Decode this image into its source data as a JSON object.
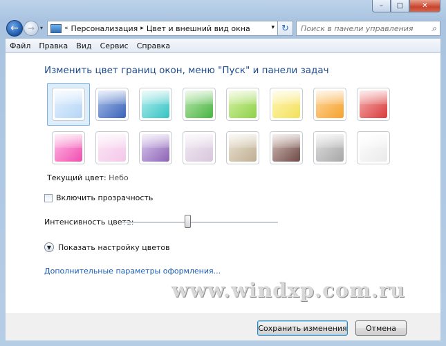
{
  "window": {
    "controls": {
      "minimize": "–",
      "maximize": "□",
      "close": "✕"
    }
  },
  "nav": {
    "back_icon": "←",
    "forward_icon": "→",
    "history_icon": "▾",
    "address": {
      "prefix": "«",
      "segments": [
        "Персонализация",
        "Цвет и внешний вид окна"
      ],
      "separator": "▸",
      "dropdown": "▾"
    },
    "refresh_icon": "↻",
    "search": {
      "placeholder": "Поиск в панели управления",
      "icon": "⌕"
    }
  },
  "menu": [
    "Файл",
    "Правка",
    "Вид",
    "Сервис",
    "Справка"
  ],
  "main": {
    "title": "Изменить цвет границ окон, меню \"Пуск\" и панели задач",
    "swatches": [
      {
        "name": "sky",
        "colors": [
          "#e4f1ff",
          "#b6d6f6"
        ]
      },
      {
        "name": "twilight",
        "colors": [
          "#a9c0ea",
          "#3b63b8"
        ]
      },
      {
        "name": "sea",
        "colors": [
          "#b8efee",
          "#36c3c4"
        ]
      },
      {
        "name": "leaf",
        "colors": [
          "#bfe9b2",
          "#48b442"
        ]
      },
      {
        "name": "lime",
        "colors": [
          "#d9f2a9",
          "#8dd148"
        ]
      },
      {
        "name": "sun",
        "colors": [
          "#fff6b8",
          "#f3e05b"
        ]
      },
      {
        "name": "pumpkin",
        "colors": [
          "#ffd9a0",
          "#f5a22f"
        ]
      },
      {
        "name": "ruby",
        "colors": [
          "#f7b2b2",
          "#d93b3b"
        ]
      },
      {
        "name": "fuchsia",
        "colors": [
          "#ffc0e6",
          "#f04eb0"
        ]
      },
      {
        "name": "blush",
        "colors": [
          "#fde8f6",
          "#f3c7ea"
        ]
      },
      {
        "name": "violet",
        "colors": [
          "#dccdf0",
          "#8d64b5"
        ]
      },
      {
        "name": "lavender",
        "colors": [
          "#f1eaf3",
          "#d9c7dd"
        ]
      },
      {
        "name": "taupe",
        "colors": [
          "#ece5d6",
          "#bfae92"
        ]
      },
      {
        "name": "chocolate",
        "colors": [
          "#d7c1bd",
          "#6e4a45"
        ]
      },
      {
        "name": "slate",
        "colors": [
          "#e2e2e2",
          "#a6a6a6"
        ]
      },
      {
        "name": "frost",
        "colors": [
          "#ffffff",
          "#e9e9e9"
        ]
      }
    ],
    "current_label": "Текущий цвет:",
    "current_value": "Небо",
    "transparency_label": "Включить прозрачность",
    "intensity_label": "Интенсивность цвета:",
    "intensity_value": 0.42,
    "show_mixer": "Показать настройку цветов",
    "advanced_link": "Дополнительные параметры оформления...",
    "watermark": "www.windxp.com.ru"
  },
  "footer": {
    "save": "Сохранить изменения",
    "cancel": "Отмена"
  }
}
